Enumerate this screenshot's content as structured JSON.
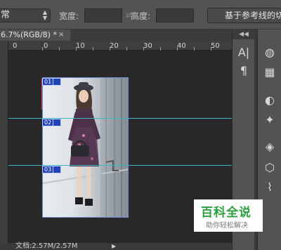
{
  "options": {
    "mode_value": "常",
    "width_label": "宽度:",
    "height_label": "高度:",
    "ref_button_label": "基于参考线的切"
  },
  "document_tab": {
    "title": "6.7%(RGB/8) *",
    "close": "×"
  },
  "ruler": {
    "ticks": [
      "0",
      "10",
      "20",
      "30",
      "40",
      "50"
    ],
    "left_marker": "0"
  },
  "slices": [
    {
      "badge": "01"
    },
    {
      "badge": "02"
    },
    {
      "badge": "03"
    }
  ],
  "panels": {
    "collapse_label": "◀◀",
    "left_icons": [
      "A|",
      "¶"
    ],
    "right_icons": [
      "palette-icon",
      "grid-icon",
      "adjust-icon",
      "fx-icon",
      "mask-icon",
      "layers-icon",
      "paths-icon"
    ]
  },
  "status": {
    "text": "文档:2.57M/2.57M",
    "arrow": "▶"
  },
  "watermark": {
    "title": "百科全说",
    "subtitle": "助你轻松解决"
  },
  "colors": {
    "slice_line": "#3fb6c6",
    "slice_badge": "#2142b8",
    "watermark_green": "#2ca03c"
  }
}
